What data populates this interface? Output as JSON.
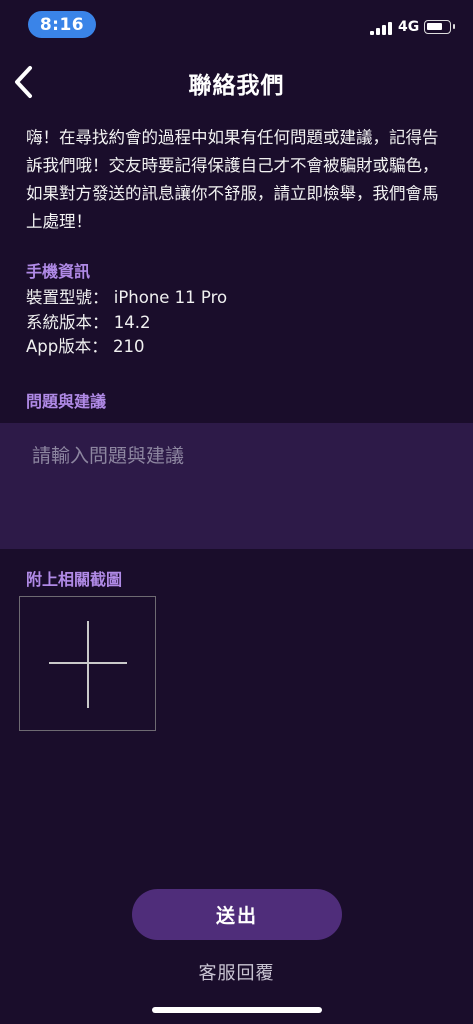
{
  "status_bar": {
    "time": "8:16",
    "network": "4G"
  },
  "nav": {
    "title": "聯絡我們",
    "back_icon": "chevron-left-icon"
  },
  "intro_text": "嗨！在尋找約會的過程中如果有任何問題或建議，記得告訴我們哦！交友時要記得保護自己才不會被騙財或騙色，如果對方發送的訊息讓你不舒服，請立即檢舉，我們會馬上處理！",
  "device_info": {
    "section_title": "手機資訊",
    "model": "裝置型號： iPhone 11 Pro",
    "os_version": "系統版本： 14.2",
    "app_version": "App版本： 210"
  },
  "feedback": {
    "section_title": "問題與建議",
    "value": "",
    "placeholder": "請輸入問題與建議"
  },
  "attachment": {
    "section_title": "附上相關截圖",
    "add_icon": "plus-icon"
  },
  "actions": {
    "submit_label": "送出",
    "customer_service_label": "客服回覆"
  },
  "colors": {
    "background": "#1a0d2b",
    "accent": "#b08ae6",
    "button": "#4f2d7a",
    "input_bg": "#2d1a48",
    "time_pill": "#3a84e8"
  }
}
